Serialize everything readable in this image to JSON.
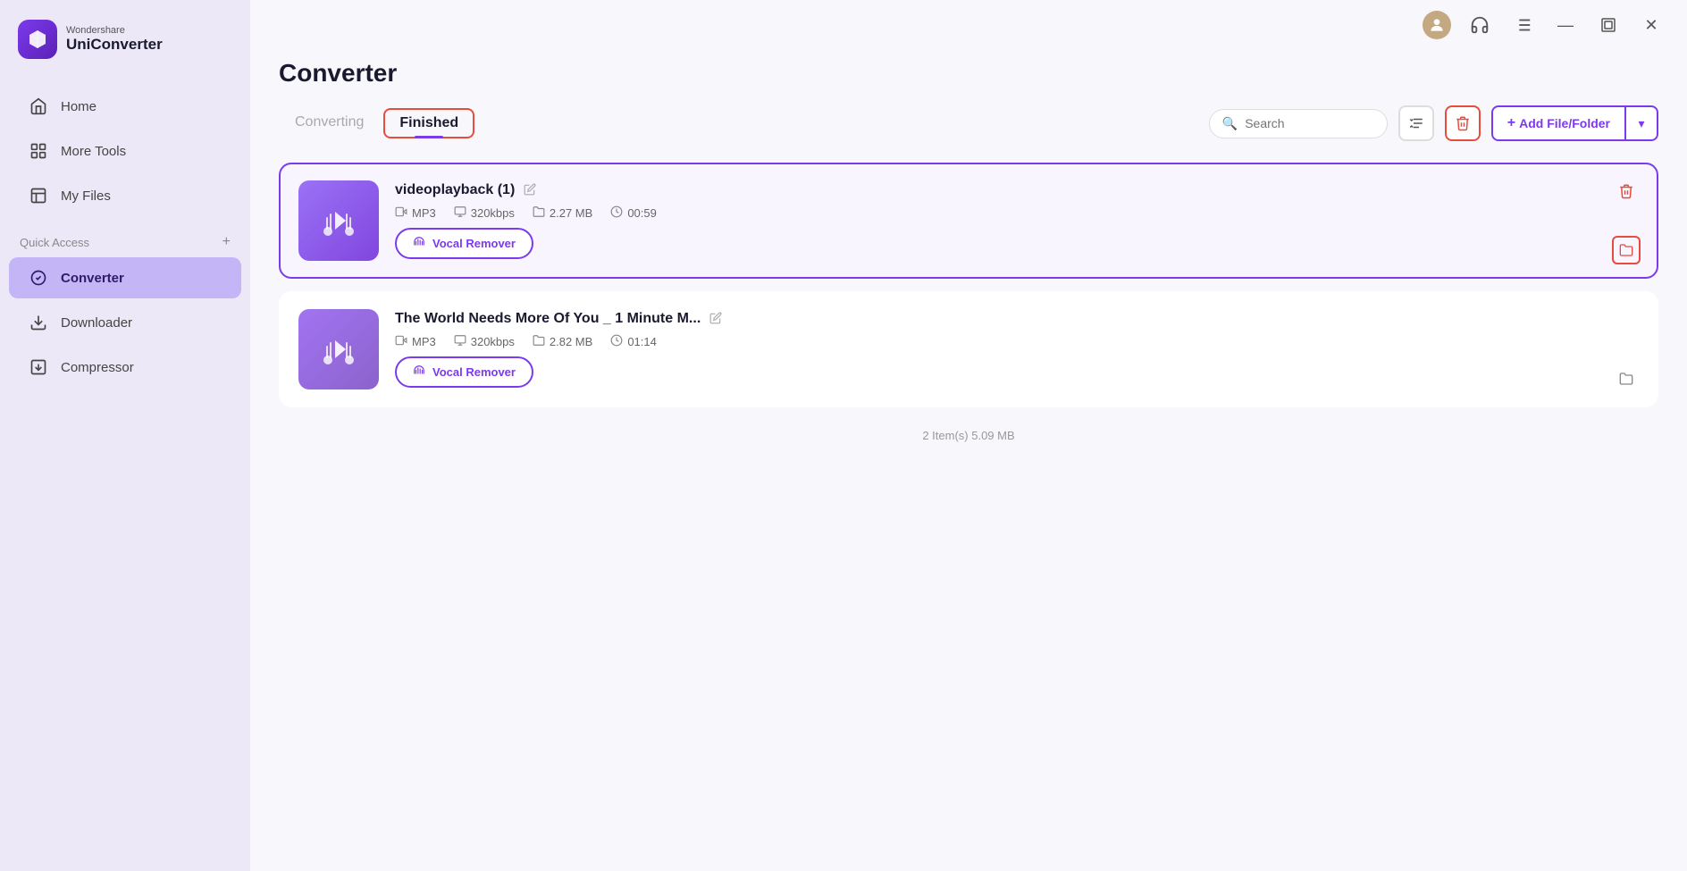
{
  "app": {
    "brand": "Wondershare",
    "product": "UniConverter"
  },
  "sidebar": {
    "nav_items": [
      {
        "id": "home",
        "label": "Home",
        "icon": "home-icon"
      },
      {
        "id": "more-tools",
        "label": "More Tools",
        "icon": "more-tools-icon"
      },
      {
        "id": "my-files",
        "label": "My Files",
        "icon": "my-files-icon"
      }
    ],
    "quick_access_label": "Quick Access",
    "quick_access_items": [
      {
        "id": "converter",
        "label": "Converter",
        "icon": "converter-icon",
        "active": true
      },
      {
        "id": "downloader",
        "label": "Downloader",
        "icon": "downloader-icon"
      },
      {
        "id": "compressor",
        "label": "Compressor",
        "icon": "compressor-icon"
      }
    ]
  },
  "topbar": {
    "icons": [
      "avatar",
      "headset",
      "list",
      "minimize",
      "maximize",
      "close"
    ]
  },
  "page": {
    "title": "Converter",
    "tabs": [
      {
        "id": "converting",
        "label": "Converting",
        "active": false
      },
      {
        "id": "finished",
        "label": "Finished",
        "active": true
      }
    ],
    "search_placeholder": "Search",
    "add_file_label": "Add File/Folder",
    "files": [
      {
        "id": 1,
        "name": "videoplayback (1)",
        "format": "MP3",
        "bitrate": "320kbps",
        "size": "2.27 MB",
        "duration": "00:59",
        "highlighted": true,
        "vocal_remover_label": "Vocal Remover"
      },
      {
        "id": 2,
        "name": "The World Needs More Of You _ 1 Minute M...",
        "format": "MP3",
        "bitrate": "320kbps",
        "size": "2.82 MB",
        "duration": "01:14",
        "highlighted": false,
        "vocal_remover_label": "Vocal Remover"
      }
    ],
    "status_bar": "2 Item(s)  5.09 MB"
  }
}
